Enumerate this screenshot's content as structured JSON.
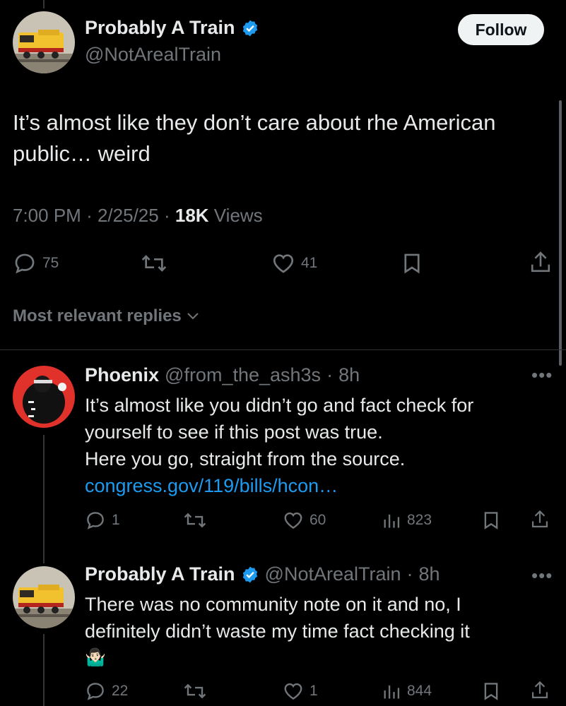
{
  "main_tweet": {
    "author_name": "Probably A Train",
    "author_handle": "@NotArealTrain",
    "follow_label": "Follow",
    "text": "It’s almost like they don’t care about rhe American public… weird",
    "time": "7:00 PM",
    "date": "2/25/25",
    "views_count": "18K",
    "views_label": "Views",
    "reply_count": "75",
    "retweet_count": "",
    "like_count": "41"
  },
  "replies_sort": {
    "label": "Most relevant replies"
  },
  "replies": [
    {
      "author_name": "Phoenix",
      "author_handle": "@from_the_ash3s",
      "age": "8h",
      "text_lines": [
        "It’s almost like you didn’t go and fact check for",
        "yourself to see if this post was true.",
        "Here you go, straight from the source."
      ],
      "link": "congress.gov/119/bills/hcon…",
      "reply_count": "1",
      "like_count": "60",
      "views_count": "823"
    },
    {
      "author_name": "Probably A Train",
      "author_handle": "@NotArealTrain",
      "age": "8h",
      "text_lines": [
        "There was no community note on it and no, I",
        "definitely didn’t waste my time fact checking it"
      ],
      "emoji": "🤷🏻‍♂️",
      "reply_count": "22",
      "like_count": "1",
      "views_count": "844"
    }
  ],
  "separator": "·",
  "colors": {
    "background": "#000000",
    "text": "#e7e9ea",
    "muted": "#71767b",
    "link": "#1d9bf0",
    "verified": "#1d9bf0"
  }
}
